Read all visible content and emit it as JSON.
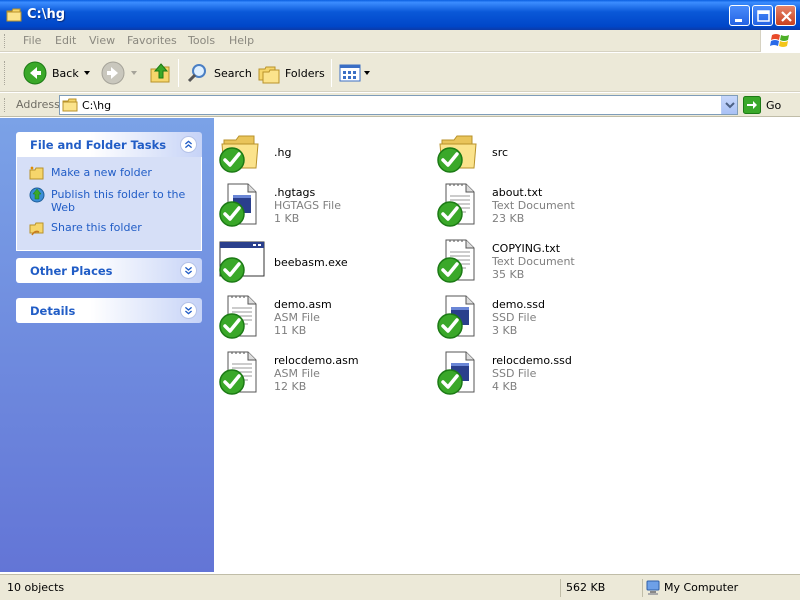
{
  "window": {
    "title": "C:\\hg"
  },
  "menu": [
    "File",
    "Edit",
    "View",
    "Favorites",
    "Tools",
    "Help"
  ],
  "toolbar": {
    "back": "Back",
    "search": "Search",
    "folders": "Folders"
  },
  "address": {
    "label": "Address",
    "value": "C:\\hg",
    "go": "Go"
  },
  "tasks": {
    "file_folder": {
      "title": "File and Folder Tasks",
      "items": [
        "Make a new folder",
        "Publish this folder to the Web",
        "Share this folder"
      ]
    },
    "other_places": {
      "title": "Other Places"
    },
    "details": {
      "title": "Details"
    }
  },
  "files": [
    {
      "name": ".hg",
      "type": "",
      "size": "",
      "icon": "folder"
    },
    {
      "name": "src",
      "type": "",
      "size": "",
      "icon": "folder"
    },
    {
      "name": ".hgtags",
      "type": "HGTAGS File",
      "size": "1 KB",
      "icon": "file"
    },
    {
      "name": "about.txt",
      "type": "Text Document",
      "size": "23 KB",
      "icon": "text"
    },
    {
      "name": "beebasm.exe",
      "type": "",
      "size": "",
      "icon": "exe"
    },
    {
      "name": "COPYING.txt",
      "type": "Text Document",
      "size": "35 KB",
      "icon": "text"
    },
    {
      "name": "demo.asm",
      "type": "ASM File",
      "size": "11 KB",
      "icon": "text"
    },
    {
      "name": "demo.ssd",
      "type": "SSD File",
      "size": "3 KB",
      "icon": "file"
    },
    {
      "name": "relocdemo.asm",
      "type": "ASM File",
      "size": "12 KB",
      "icon": "text"
    },
    {
      "name": "relocdemo.ssd",
      "type": "SSD File",
      "size": "4 KB",
      "icon": "file"
    }
  ],
  "status": {
    "objects": "10 objects",
    "size": "562 KB",
    "location": "My Computer"
  }
}
